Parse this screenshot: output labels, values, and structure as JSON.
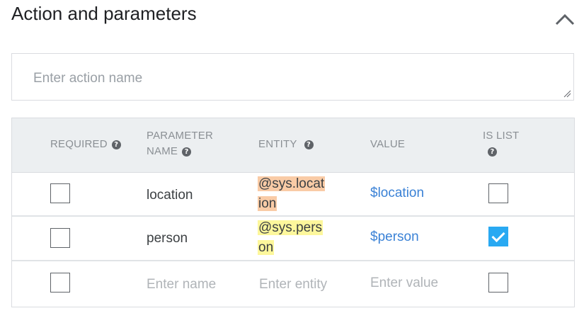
{
  "section": {
    "title": "Action and parameters"
  },
  "action": {
    "placeholder": "Enter action name"
  },
  "table": {
    "headers": {
      "required": "REQUIRED",
      "parameter_name_1": "PARAMETER",
      "parameter_name_2": "NAME",
      "entity": "ENTITY",
      "value": "VALUE",
      "is_list_1": "IS LIST"
    },
    "help_glyph": "?",
    "rows": [
      {
        "required": false,
        "name": "location",
        "entity_line1": "@sys.locat",
        "entity_line2": "ion",
        "entity_color": "#f9cba6",
        "value": "$location",
        "is_list": false
      },
      {
        "required": false,
        "name": "person",
        "entity_line1": "@sys.pers",
        "entity_line2": "on",
        "entity_color": "#fdf79c",
        "value": "$person",
        "is_list": true
      }
    ],
    "new_row": {
      "name_placeholder": "Enter name",
      "entity_placeholder": "Enter entity",
      "value_placeholder": "Enter value"
    }
  },
  "colors": {
    "link": "#3b82d6",
    "checked": "#29a9f2",
    "header_bg": "#eceff1"
  }
}
